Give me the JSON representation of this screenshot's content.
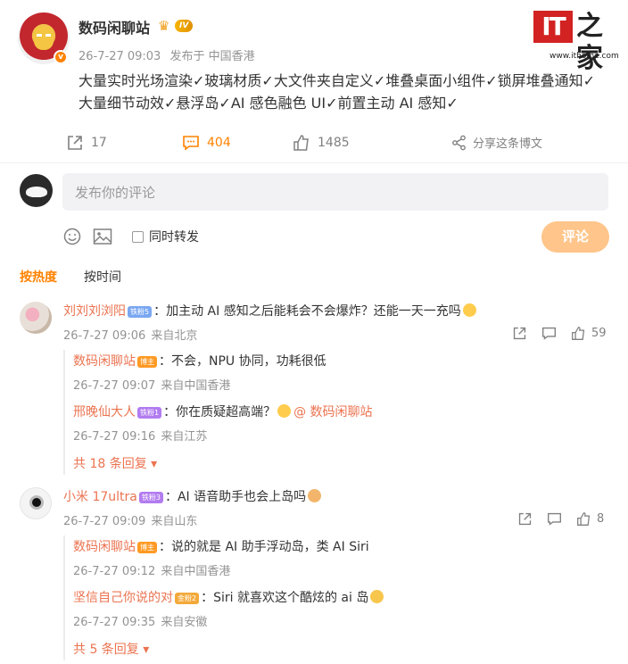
{
  "post": {
    "username": "数码闲聊站",
    "level_badge": "IV",
    "time": "26-7-27 09:03",
    "location": "发布于 中国香港",
    "line1": "大量实时光场渲染✓玻璃材质✓大文件夹自定义✓堆叠桌面小组件✓锁屏堆叠通知✓",
    "line2": "大量细节动效✓悬浮岛✓AI 感色融色 UI✓前置主动 AI 感知✓"
  },
  "watermark": {
    "logo_it": "IT",
    "logo_zh": "之家",
    "url": "www.ithome.com"
  },
  "actions": {
    "forward_count": "17",
    "comment_count": "404",
    "like_count": "1485",
    "share_label": "分享这条博文"
  },
  "composer": {
    "placeholder": "发布你的评论",
    "forward_label": "同时转发",
    "submit_label": "评论"
  },
  "sort": {
    "hot": "按热度",
    "time": "按时间"
  },
  "comments": [
    {
      "user": "刘刘刘浏阳",
      "badge": "铁粉5",
      "text": "：加主动 AI 感知之后能耗会不会爆炸？还能一天一充吗",
      "time": "26-7-27 09:06",
      "location": "来自北京",
      "likes": "59",
      "replies": [
        {
          "user": "数码闲聊站",
          "badge": "博主",
          "text": "：不会，NPU 协同，功耗很低",
          "time": "26-7-27 09:07",
          "location": "来自中国香港"
        },
        {
          "user": "邢晚仙大人",
          "badge": "铁粉1",
          "text": "：你在质疑超高端？",
          "mention": "@ 数码闲聊站",
          "time": "26-7-27 09:16",
          "location": "来自江苏"
        }
      ],
      "more": "共 18 条回复"
    },
    {
      "user": "小米 17ultra",
      "badge": "铁粉3",
      "text": "：AI 语音助手也会上岛吗",
      "time": "26-7-27 09:09",
      "location": "来自山东",
      "likes": "8",
      "replies": [
        {
          "user": "数码闲聊站",
          "badge": "博主",
          "text": "：说的就是 AI 助手浮动岛，类 AI Siri",
          "time": "26-7-27 09:12",
          "location": "来自中国香港"
        },
        {
          "user": "坚信自己你说的对",
          "badge": "金粉2",
          "text": "：Siri 就喜欢这个酷炫的 ai 岛",
          "time": "26-7-27 09:35",
          "location": "来自安徽"
        }
      ],
      "more": "共 5 条回复"
    }
  ]
}
